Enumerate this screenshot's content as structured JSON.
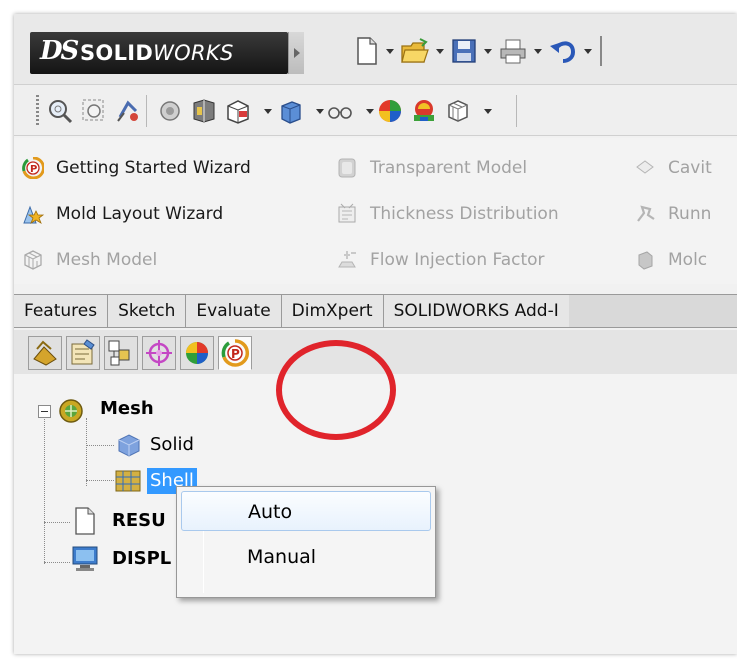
{
  "brand": {
    "ds": "DS",
    "name_bold": "SOLID",
    "name_light": "WORKS"
  },
  "colors": {
    "accent_red": "#e0242b",
    "selection_blue": "#3399ff",
    "brand_dark": "#1e1e1e"
  },
  "top_toolbar": [
    "new-document-icon",
    "open-folder-icon",
    "save-icon",
    "print-icon",
    "undo-icon"
  ],
  "view_toolbar": [
    "zoom-to-fit-icon",
    "zoom-to-area-icon",
    "previous-view-icon",
    "section-view-icon",
    "view-orientation-icon",
    "display-style-icon",
    "hide-show-icon",
    "edit-appearance-icon",
    "apply-scene-icon",
    "view-settings-icon"
  ],
  "commands": {
    "col1": [
      {
        "label": "Getting Started Wizard",
        "icon": "wizard-icon",
        "enabled": true
      },
      {
        "label": "Mold Layout Wizard",
        "icon": "mold-layout-icon",
        "enabled": true
      },
      {
        "label": "Mesh Model",
        "icon": "mesh-model-icon",
        "enabled": false
      }
    ],
    "col2": [
      {
        "label": "Transparent Model",
        "icon": "transparent-model-icon",
        "enabled": false
      },
      {
        "label": "Thickness Distribution",
        "icon": "thickness-icon",
        "enabled": false
      },
      {
        "label": "Flow Injection Factor",
        "icon": "flow-injection-icon",
        "enabled": false
      }
    ],
    "col3": [
      {
        "label": "Cavit",
        "icon": "cavity-icon",
        "enabled": false
      },
      {
        "label": "Runn",
        "icon": "runner-icon",
        "enabled": false
      },
      {
        "label": "Molc",
        "icon": "mold-icon",
        "enabled": false
      }
    ]
  },
  "tabs": [
    "Features",
    "Sketch",
    "Evaluate",
    "DimXpert",
    "SOLIDWORKS Add-I"
  ],
  "manager_tabs": [
    "feature-manager-icon",
    "property-manager-icon",
    "configuration-manager-icon",
    "dimxpert-manager-icon",
    "display-manager-icon",
    "plastics-manager-icon"
  ],
  "tree": {
    "mesh": "Mesh",
    "solid": "Solid",
    "shell": "Shell",
    "results": "RESU",
    "display": "DISPL"
  },
  "context_menu": {
    "items": [
      "Auto",
      "Manual"
    ]
  }
}
